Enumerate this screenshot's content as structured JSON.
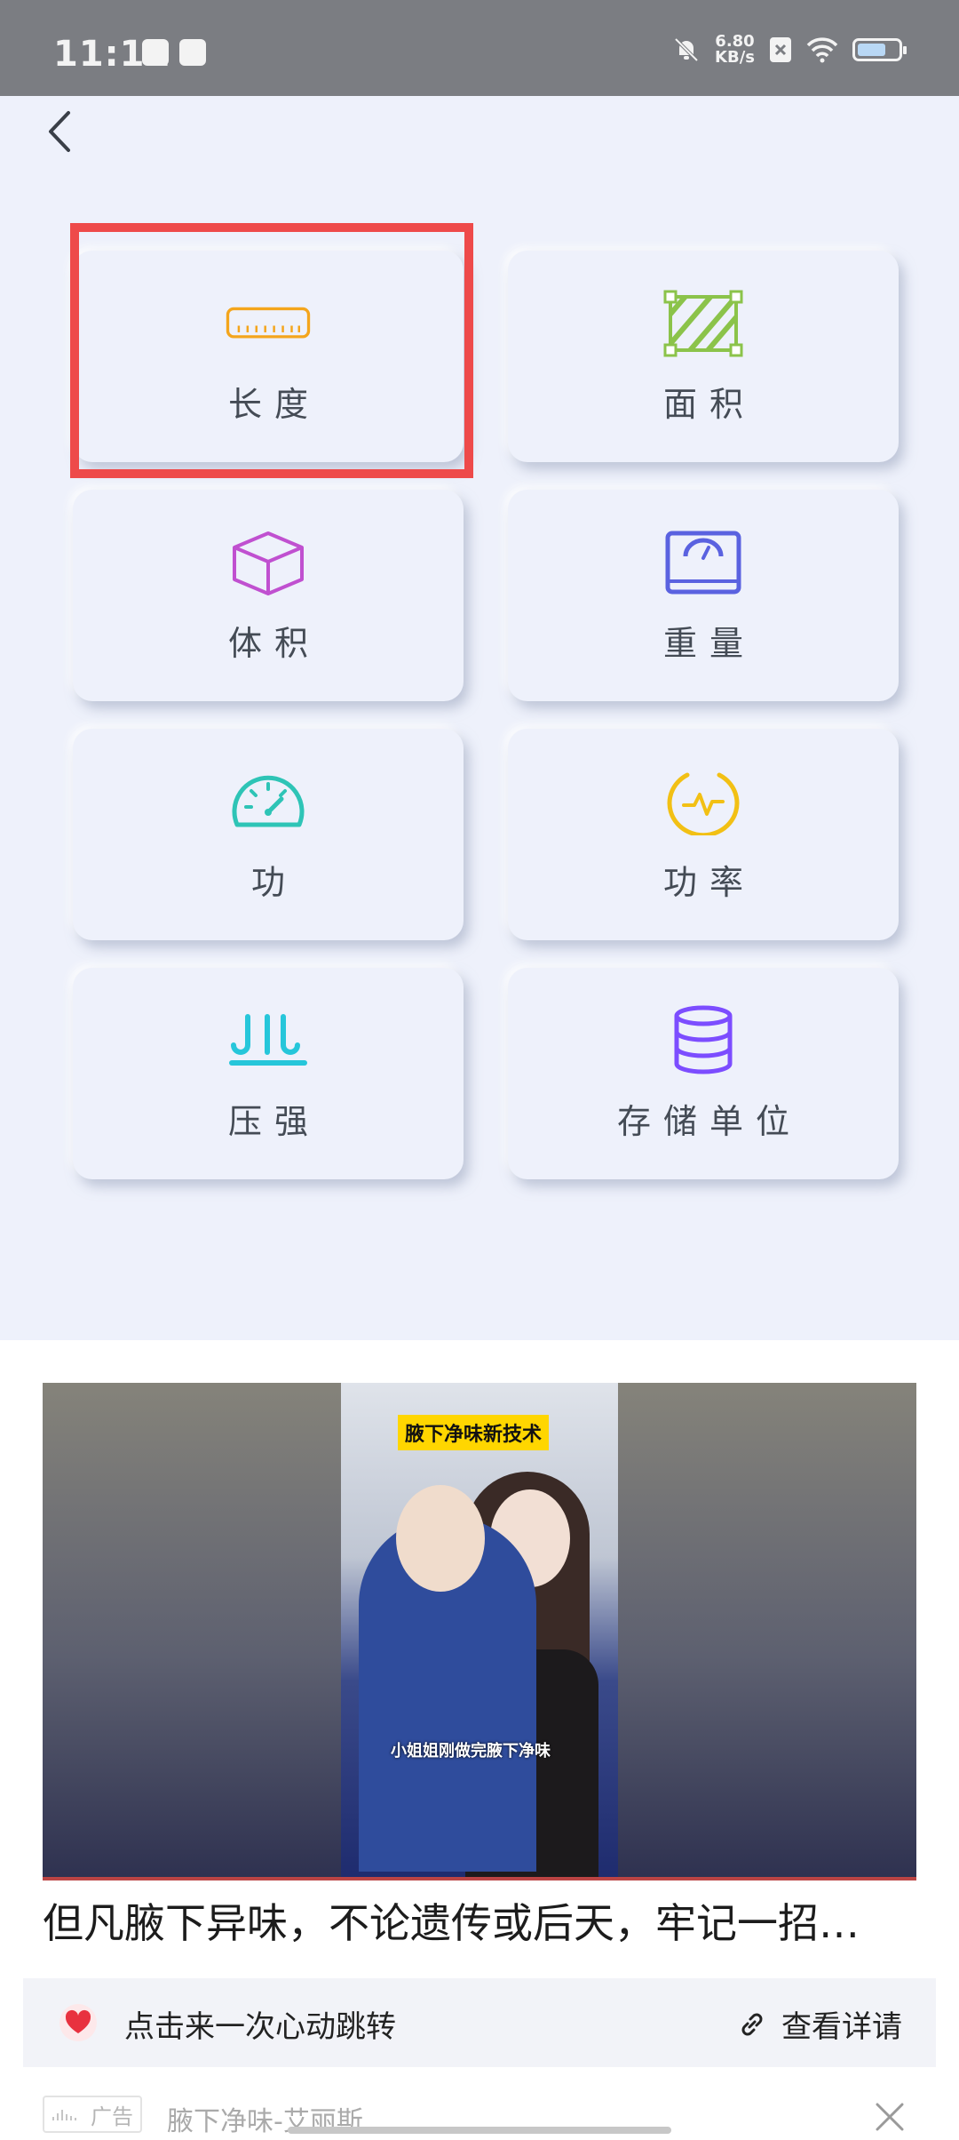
{
  "status_bar": {
    "time": "11:11",
    "net_speed_value": "6.80",
    "net_speed_unit": "KB/s",
    "battery_level": 0.7
  },
  "units": [
    {
      "label": "长度",
      "icon": "ruler-icon",
      "color": "#f4a51c"
    },
    {
      "label": "面积",
      "icon": "area-icon",
      "color": "#8bc34a"
    },
    {
      "label": "体积",
      "icon": "cube-icon",
      "color": "#c050d0"
    },
    {
      "label": "重量",
      "icon": "scale-icon",
      "color": "#5a62e0"
    },
    {
      "label": "功",
      "icon": "speedometer-icon",
      "color": "#2ec4b6"
    },
    {
      "label": "功率",
      "icon": "power-wave-icon",
      "color": "#f2c014"
    },
    {
      "label": "压强",
      "icon": "pressure-icon",
      "color": "#26c6da"
    },
    {
      "label": "存储单位",
      "icon": "database-icon",
      "color": "#7c4dff"
    }
  ],
  "ad": {
    "video_tag": "腋下净味新技术",
    "video_subtitle": "小姐姐刚做完腋下净味",
    "title": "但凡腋下异味，不论遗传或后天，牢记一招…",
    "cta_left": "点击来一次心动跳转",
    "cta_right": "查看详请",
    "badge": "广告",
    "source": "腋下净味-艾丽斯"
  }
}
